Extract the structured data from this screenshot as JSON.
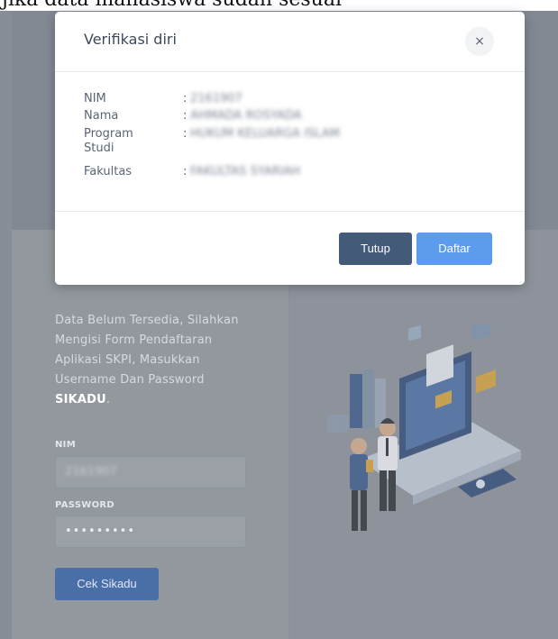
{
  "caption_fragment": "jika data mahasiswa sudah sesuai",
  "modal": {
    "title": "Verifikasi diri",
    "close_symbol": "×",
    "rows": [
      {
        "label": "NIM",
        "separator": ":",
        "value": "2161907"
      },
      {
        "label": "Nama",
        "separator": ":",
        "value": "AHMADA ROSYADA"
      },
      {
        "label": "Program Studi",
        "separator": ":",
        "value": "HUKUM KELUARGA ISLAM"
      },
      {
        "label": "Fakultas",
        "separator": ":",
        "value": "FAKULTAS SYARIAH"
      }
    ],
    "buttons": {
      "close_label": "Tutup",
      "register_label": "Daftar"
    }
  },
  "login": {
    "info_text_before": "Data Belum Tersedia, Silahkan Mengisi Form Pendaftaran Aplikasi SKPI, Masukkan Username Dan Password ",
    "info_text_emphasis": "SIKADU",
    "info_text_after": ".",
    "nim_label": "NIM",
    "nim_value": "2161907",
    "password_label": "PASSWORD",
    "password_value": "•••••••••",
    "submit_label": "Cek Sikadu"
  },
  "colors": {
    "primary_dark": "#435a78",
    "primary_light": "#5b9cec",
    "cek_button": "#4a6fa8"
  },
  "icons": {
    "close": "close-icon",
    "illustration": "business-handshake-illustration"
  }
}
